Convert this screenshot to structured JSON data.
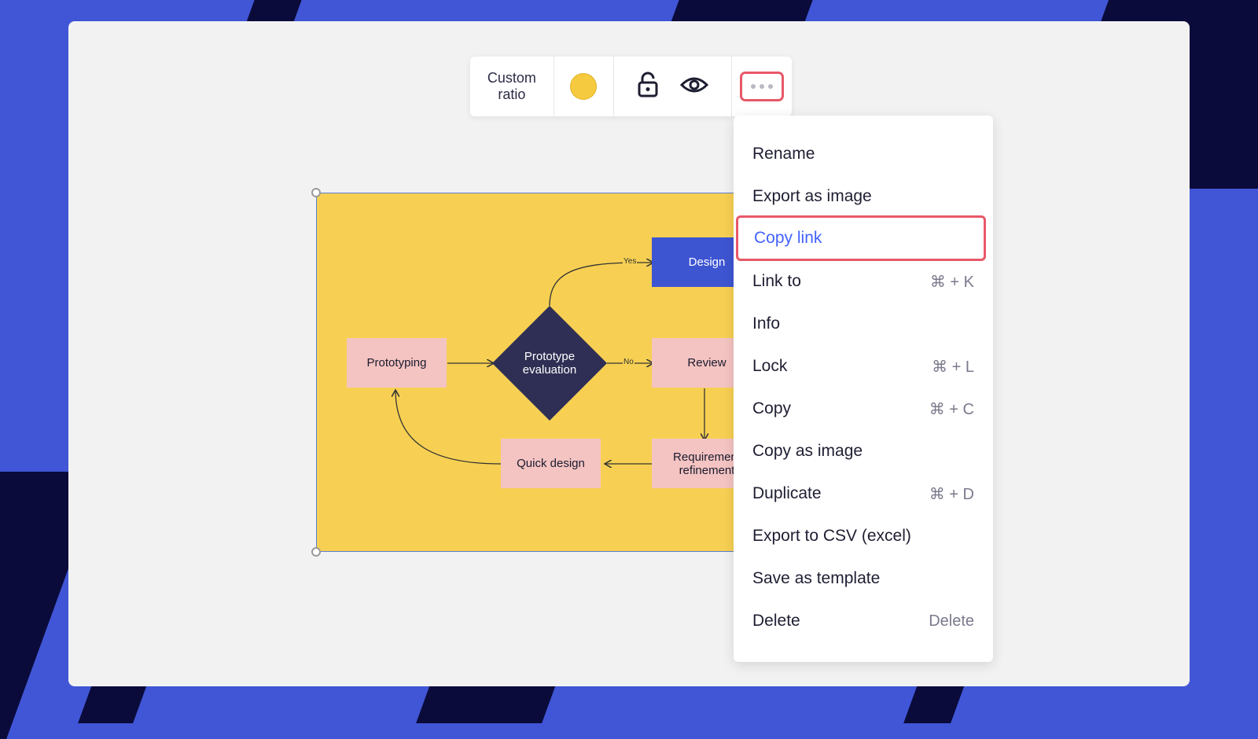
{
  "toolbar": {
    "ratio_label": "Custom\nratio",
    "color_swatch": "#f6ca3f",
    "icons": [
      "unlock-icon",
      "eye-icon",
      "more-icon"
    ]
  },
  "diagram": {
    "nodes": {
      "design": "Design",
      "prototyping": "Prototyping",
      "evaluation": "Prototype evaluation",
      "review": "Review",
      "quick_design": "Quick design",
      "requirement": "Requirement refinement"
    },
    "labels": {
      "yes": "Yes",
      "no": "No"
    }
  },
  "menu": {
    "items": [
      {
        "label": "Rename",
        "shortcut": ""
      },
      {
        "label": "Export as image",
        "shortcut": ""
      },
      {
        "label": "Copy link",
        "shortcut": ""
      },
      {
        "label": "Link to",
        "shortcut": "⌘ + K"
      },
      {
        "label": "Info",
        "shortcut": ""
      },
      {
        "label": "Lock",
        "shortcut": "⌘ + L"
      },
      {
        "label": "Copy",
        "shortcut": "⌘ + C"
      },
      {
        "label": "Copy as image",
        "shortcut": ""
      },
      {
        "label": "Duplicate",
        "shortcut": "⌘ + D"
      },
      {
        "label": "Export to CSV (excel)",
        "shortcut": ""
      },
      {
        "label": "Save as template",
        "shortcut": ""
      },
      {
        "label": "Delete",
        "shortcut": "Delete"
      }
    ]
  },
  "colors": {
    "background": "#4056d6",
    "stripe": "#0b0b3b",
    "frame_fill": "#f7d053",
    "highlight": "#e85868",
    "accent": "#4262ff"
  }
}
